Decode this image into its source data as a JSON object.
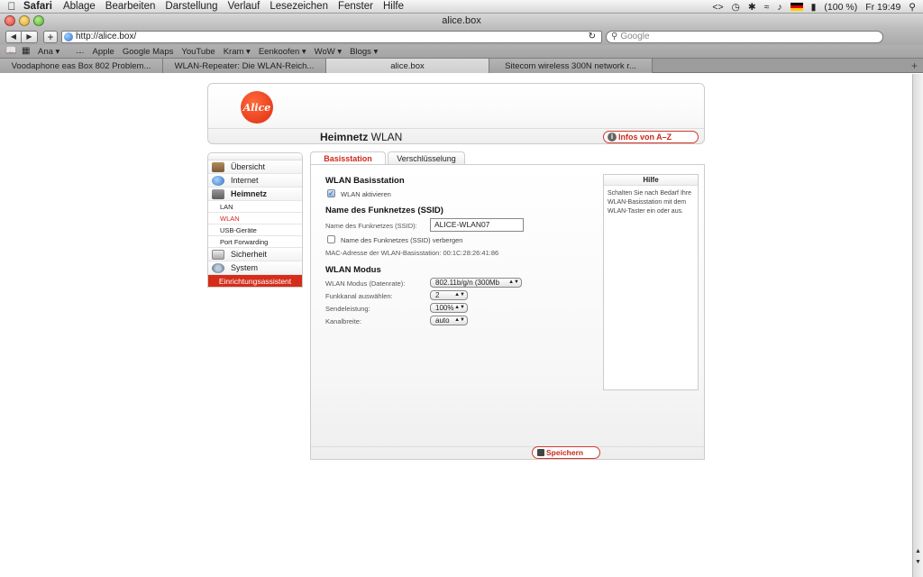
{
  "menubar": {
    "app": "Safari",
    "items": [
      "Ablage",
      "Bearbeiten",
      "Darstellung",
      "Verlauf",
      "Lesezeichen",
      "Fenster",
      "Hilfe"
    ],
    "battery": "(100 %)",
    "clock": "Fr 19:49"
  },
  "window": {
    "title": "alice.box"
  },
  "toolbar": {
    "url": "http://alice.box/",
    "search_placeholder": "Google"
  },
  "bookmarks": [
    "Ana ▾",
    "ﾠ·-·",
    "Apple",
    "Google Maps",
    "YouTube",
    "Kram ▾",
    "Eenkoofen ▾",
    "WoW ▾",
    "Blogs ▾"
  ],
  "tabs": [
    {
      "label": "Voodaphone eas Box 802 Problem..."
    },
    {
      "label": "WLAN-Repeater: Die WLAN-Reich..."
    },
    {
      "label": "alice.box",
      "active": true
    },
    {
      "label": "Sitecom wireless 300N network r..."
    }
  ],
  "router": {
    "logo_text": "Alice",
    "title_bold": "Heimnetz",
    "title_rest": " WLAN",
    "infos_button": "Infos von A–Z",
    "nav": {
      "items": [
        "Übersicht",
        "Internet",
        "Heimnetz"
      ],
      "sub_items": [
        "LAN",
        "WLAN",
        "USB-Geräte",
        "Port Forwarding"
      ],
      "items_after": [
        "Sicherheit",
        "System"
      ],
      "assistant": "Einrichtungsassistent"
    },
    "content_tabs": [
      "Basisstation",
      "Verschlüsselung"
    ],
    "section_basis": "WLAN Basisstation",
    "wlan_activate_label": "WLAN aktivieren",
    "wlan_activate_checked": true,
    "section_ssid": "Name des Funknetzes (SSID)",
    "ssid_label": "Name des Funknetzes (SSID):",
    "ssid_value": "ALICE-WLAN07",
    "hide_ssid_label": "Name des Funknetzes (SSID) verbergen",
    "hide_ssid_checked": false,
    "mac_label": "MAC-Adresse der WLAN-Basisstation: 00:1C:28:26:41:86",
    "section_mode": "WLAN Modus",
    "fields": [
      {
        "label": "WLAN Modus (Datenrate):",
        "value": "802.11b/g/n (300Mb"
      },
      {
        "label": "Funkkanal auswählen:",
        "value": "2"
      },
      {
        "label": "Sendeleistung:",
        "value": "100%"
      },
      {
        "label": "Kanalbreite:",
        "value": "auto"
      }
    ],
    "help_title": "Hilfe",
    "help_text": "Schalten Sie nach Bedarf Ihre WLAN-Basisstation mit dem WLAN-Taster ein oder aus.",
    "save_button": "Speichern"
  },
  "colors": {
    "accent": "#d52d1a"
  }
}
